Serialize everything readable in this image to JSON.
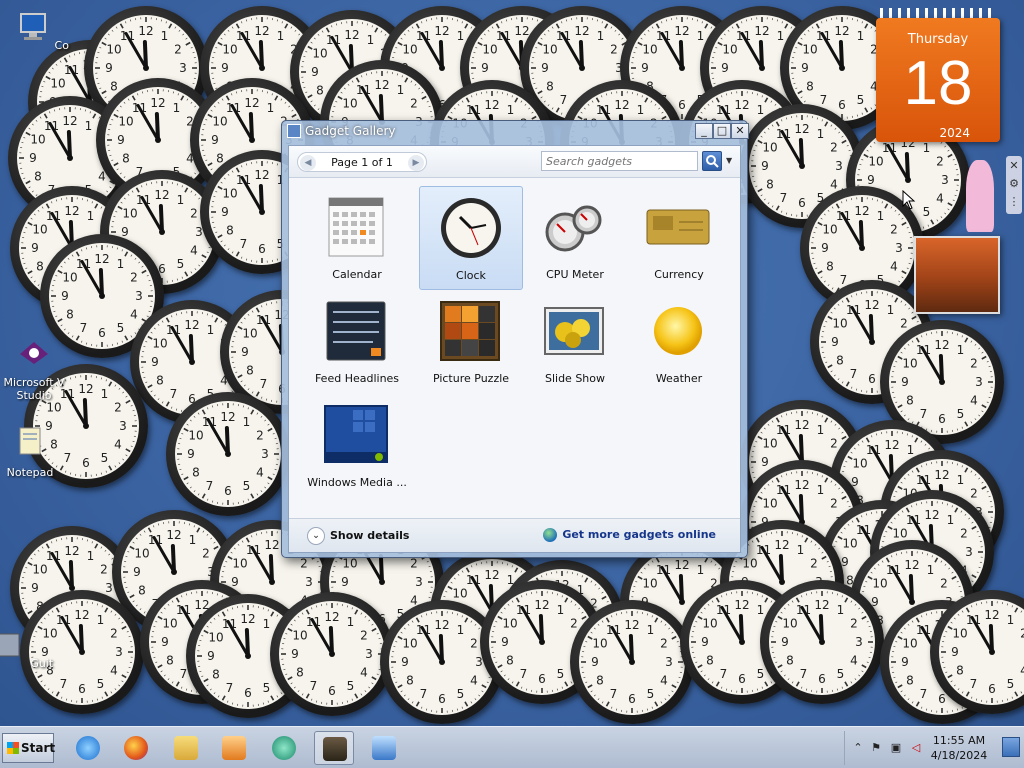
{
  "desktop": {
    "icons": [
      {
        "label": "Co",
        "icon": "computer-icon"
      },
      {
        "label": "Microsoft V Studio",
        "icon": "visual-studio-icon"
      },
      {
        "label": "Notepad",
        "icon": "notepad-icon"
      },
      {
        "label": "Guit",
        "icon": "app-shortcut-icon"
      }
    ],
    "clock_time": {
      "hour": 11,
      "minute": 55
    }
  },
  "calendar_gadget": {
    "weekday": "Thursday",
    "day": "18",
    "year": "2024"
  },
  "gallery": {
    "title": "Gadget Gallery",
    "page_label": "Page 1 of 1",
    "search_placeholder": "Search gadgets",
    "items": [
      {
        "name": "Calendar",
        "icon": "calendar-icon",
        "selected": false
      },
      {
        "name": "Clock",
        "icon": "clock-icon",
        "selected": true
      },
      {
        "name": "CPU Meter",
        "icon": "cpu-meter-icon",
        "selected": false
      },
      {
        "name": "Currency",
        "icon": "currency-icon",
        "selected": false
      },
      {
        "name": "Feed Headlines",
        "icon": "feed-headlines-icon",
        "selected": false
      },
      {
        "name": "Picture Puzzle",
        "icon": "picture-puzzle-icon",
        "selected": false
      },
      {
        "name": "Slide Show",
        "icon": "slide-show-icon",
        "selected": false
      },
      {
        "name": "Weather",
        "icon": "weather-icon",
        "selected": false
      },
      {
        "name": "Windows Media ...",
        "icon": "windows-media-center-icon",
        "selected": false
      }
    ],
    "show_details": "Show details",
    "get_more": "Get more gadgets online",
    "colors": {
      "selection": "#c9dcf4",
      "link": "#16368c"
    }
  },
  "taskbar": {
    "start_label": "Start",
    "apps": [
      {
        "icon": "internet-explorer-icon",
        "active": false
      },
      {
        "icon": "firefox-icon",
        "active": false
      },
      {
        "icon": "file-explorer-icon",
        "active": false
      },
      {
        "icon": "media-player-icon",
        "active": false
      },
      {
        "icon": "remote-app-icon",
        "active": false
      },
      {
        "icon": "gadgets-icon",
        "active": true
      },
      {
        "icon": "remote-desktop-icon",
        "active": false
      }
    ],
    "time": "11:55 AM",
    "date": "4/18/2024"
  }
}
